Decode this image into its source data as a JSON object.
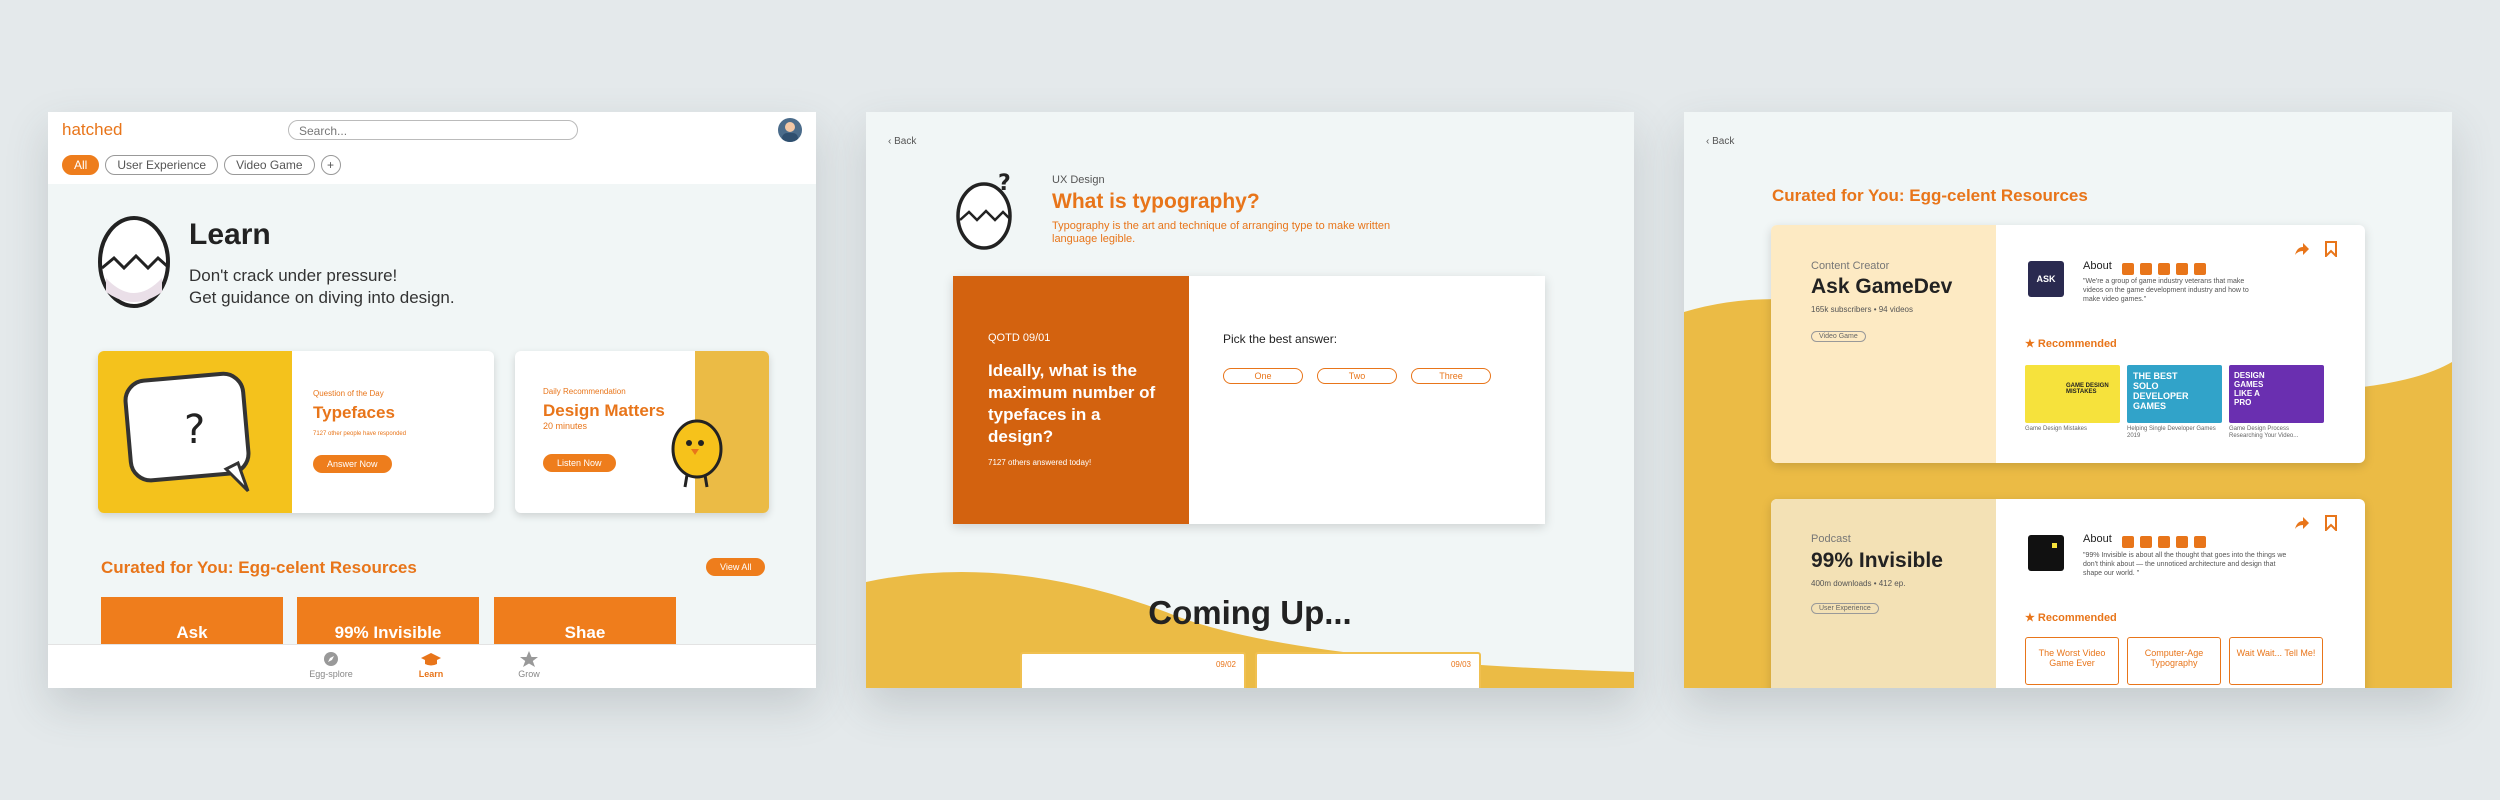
{
  "screen1": {
    "brand": "hatched",
    "search_placeholder": "Search...",
    "filters": [
      "All",
      "User Experience",
      "Video Game"
    ],
    "add_filter": "+",
    "learn_title": "Learn",
    "learn_line1": "Don't crack under pressure!",
    "learn_line2": "Get guidance on diving into design.",
    "qotd": {
      "label": "Question of the Day",
      "title": "Typefaces",
      "responded": "7127 other people have responded",
      "button": "Answer Now"
    },
    "daily": {
      "label": "Daily Recommendation",
      "title": "Design Matters",
      "duration": "20 minutes",
      "button": "Listen Now"
    },
    "curated": "Curated for You: Egg-celent Resources",
    "view_all": "View All",
    "resources": [
      "Ask",
      "99% Invisible",
      "Shae"
    ],
    "nav": [
      "Egg-splore",
      "Learn",
      "Grow"
    ]
  },
  "screen2": {
    "back": "Back",
    "category": "UX Design",
    "title": "What is typography?",
    "definition": "Typography is the art and technique of arranging type to make written language legible.",
    "qotd_label": "QOTD 09/01",
    "question": "Ideally, what is the maximum number of typefaces in a design?",
    "answered": "7127 others answered today!",
    "prompt": "Pick the best answer:",
    "options": [
      "One",
      "Two",
      "Three"
    ],
    "coming_up": "Coming Up...",
    "dates": [
      "09/02",
      "09/03"
    ]
  },
  "screen3": {
    "back": "Back",
    "heading": "Curated for You: Egg-celent Resources",
    "creator": {
      "type": "Content Creator",
      "name": "Ask GameDev",
      "stats": "165k subscribers • 94 videos",
      "tag": "Video Game",
      "about": "About",
      "about_text": "\"We're a group of game industry veterans that make videos on the game  development industry and how to make video games.\"",
      "recommended": "Recommended",
      "thumbs": [
        "GAME DESIGN MISTAKES",
        "THE BEST SOLO DEVELOPER GAMES",
        "DESIGN GAMES LIKE A PRO"
      ],
      "captions": [
        "Game Design Mistakes",
        "Helping Single Developer Games 2019",
        "Game Design Process Researching Your Video..."
      ]
    },
    "podcast": {
      "type": "Podcast",
      "name": "99% Invisible",
      "stats": "400m downloads • 412 ep.",
      "tag": "User Experience",
      "about": "About",
      "about_text": "\"99% Invisible is about all the thought that goes into the things we don't think about — the unnoticed architecture and design that shape our world. \"",
      "recommended": "Recommended",
      "episodes": [
        "The Worst Video Game Ever",
        "Computer-Age Typography",
        "Wait Wait... Tell Me!"
      ]
    }
  },
  "colors": {
    "accent": "#e8751a",
    "deep_orange": "#d3620f",
    "yellow": "#ebbb45"
  }
}
